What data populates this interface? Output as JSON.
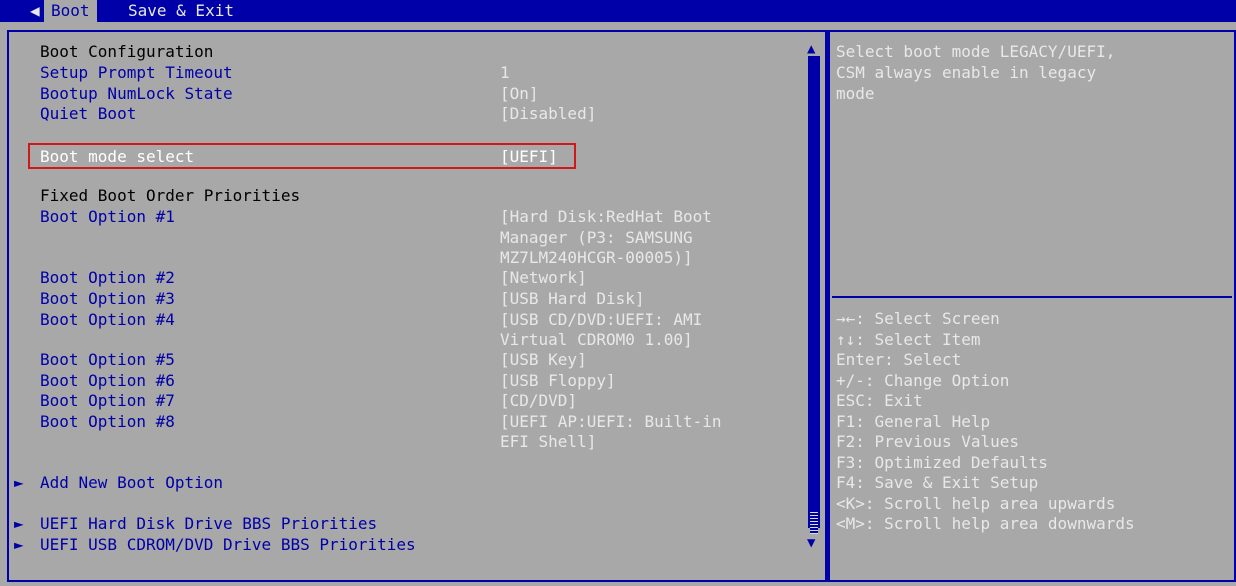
{
  "tabs": [
    {
      "label": "Boot",
      "active": true
    },
    {
      "label": "Save & Exit",
      "active": false
    }
  ],
  "left": {
    "section_boot_config": "Boot Configuration",
    "rows": [
      {
        "label": "Setup Prompt Timeout",
        "value": "1"
      },
      {
        "label": "Bootup NumLock State",
        "value": "[On]"
      },
      {
        "label": "Quiet Boot",
        "value": "[Disabled]"
      }
    ],
    "selected": {
      "label": "Boot mode select",
      "value": "[UEFI]"
    },
    "section_fixed_order": "Fixed Boot Order Priorities",
    "boot_options": [
      {
        "label": "Boot Option #1",
        "value_lines": [
          "[Hard Disk:RedHat Boot",
          "Manager (P3: SAMSUNG",
          "MZ7LM240HCGR-00005)]"
        ]
      },
      {
        "label": "Boot Option #2",
        "value_lines": [
          "[Network]"
        ]
      },
      {
        "label": "Boot Option #3",
        "value_lines": [
          "[USB Hard Disk]"
        ]
      },
      {
        "label": "Boot Option #4",
        "value_lines": [
          "[USB CD/DVD:UEFI: AMI",
          "Virtual CDROM0 1.00]"
        ]
      },
      {
        "label": "Boot Option #5",
        "value_lines": [
          "[USB Key]"
        ]
      },
      {
        "label": "Boot Option #6",
        "value_lines": [
          "[USB Floppy]"
        ]
      },
      {
        "label": "Boot Option #7",
        "value_lines": [
          "[CD/DVD]"
        ]
      },
      {
        "label": "Boot Option #8",
        "value_lines": [
          "[UEFI AP:UEFI: Built-in",
          "EFI Shell]"
        ]
      }
    ],
    "submenus": [
      "Add New Boot Option",
      "UEFI Hard Disk Drive BBS Priorities",
      "UEFI USB CDROM/DVD Drive BBS Priorities"
    ]
  },
  "help": {
    "description": [
      "Select boot mode LEGACY/UEFI,",
      "CSM always enable in legacy",
      "mode"
    ],
    "keys": [
      "→←: Select Screen",
      "↑↓: Select Item",
      "Enter: Select",
      "+/-: Change Option",
      "ESC: Exit",
      "F1: General Help",
      "F2: Previous Values",
      "F3: Optimized Defaults",
      "F4: Save & Exit Setup",
      "<K>: Scroll help area upwards",
      "<M>: Scroll help area downwards"
    ]
  },
  "colors": {
    "bg": "#a8a8a8",
    "accent": "#0000a8",
    "highlight_border": "#d01818"
  }
}
